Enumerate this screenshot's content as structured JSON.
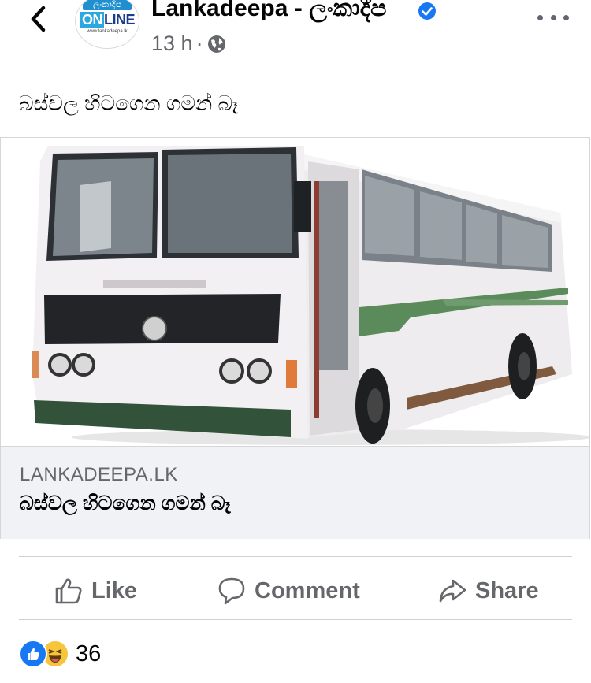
{
  "header": {
    "page_name": "Lankadeepa - ලංකාදීප",
    "time": "13 h",
    "separator": "·",
    "avatar": {
      "top_text": "ලංකාදීප",
      "online_prefix": "ON",
      "online_suffix": "LINE",
      "url": "www.lankadeepa.lk"
    }
  },
  "post": {
    "text": "බස්වල හිටගෙන ගමන් බෑ"
  },
  "link_preview": {
    "domain": "LANKADEEPA.LK",
    "title": "බස්වල හිටගෙන ගමන් බෑ",
    "image": "white-green-bus-photo"
  },
  "actions": {
    "like": "Like",
    "comment": "Comment",
    "share": "Share"
  },
  "reactions": {
    "count": "36",
    "types": [
      "like",
      "haha"
    ]
  },
  "colors": {
    "text": "#050505",
    "secondary": "#65676b",
    "verified": "#1877f2",
    "link_bg": "#f0f2f5"
  }
}
